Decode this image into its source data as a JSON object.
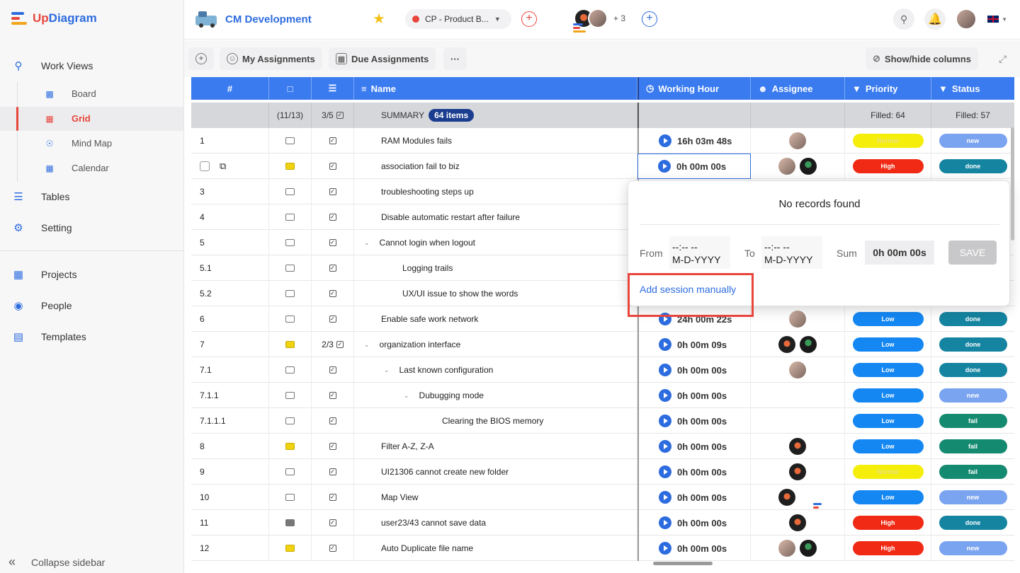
{
  "app": {
    "logo_up": "Up",
    "logo_rest": "Diagram"
  },
  "sidebar": {
    "work_views": "Work Views",
    "sub": [
      "Board",
      "Grid",
      "Mind Map",
      "Calendar"
    ],
    "tables": "Tables",
    "setting": "Setting",
    "projects": "Projects",
    "people": "People",
    "templates": "Templates",
    "collapse": "Collapse sidebar"
  },
  "topbar": {
    "project_title": "CM Development",
    "filter_label": "CP - Product B...",
    "members_more": "+ 3"
  },
  "toolbar": {
    "my_assignments": "My Assignments",
    "due_assignments": "Due Assignments",
    "more": "···",
    "show_hide": "Show/hide columns"
  },
  "grid": {
    "headers": {
      "num": "#",
      "name": "Name",
      "working_hour": "Working Hour",
      "assignee": "Assignee",
      "priority": "Priority",
      "status": "Status"
    },
    "summary": {
      "comments": "(11/13)",
      "checks": "3/5",
      "label": "SUMMARY",
      "items": "64 items",
      "priority_filled": "Filled: 64",
      "status_filled": "Filled: 57"
    },
    "rows": [
      {
        "num": "1",
        "cmt": "n",
        "chk": "",
        "name": "RAM Modules fails",
        "indent": 0,
        "caret": false,
        "time": "16h 03m 48s",
        "assignees": [
          "photo"
        ],
        "priority": "Normal",
        "status": "new"
      },
      {
        "num": "",
        "cmt": "y",
        "chk": "",
        "name": "association fail to biz",
        "indent": 0,
        "caret": false,
        "time": "0h 00m 00s",
        "assignees": [
          "photo",
          "green"
        ],
        "priority": "High",
        "status": "done"
      },
      {
        "num": "3",
        "cmt": "n",
        "chk": "",
        "name": "troubleshooting steps up",
        "indent": 0,
        "caret": false,
        "time": "",
        "assignees": [],
        "priority": "",
        "status": ""
      },
      {
        "num": "4",
        "cmt": "n",
        "chk": "",
        "name": "Disable automatic restart after failure",
        "indent": 0,
        "caret": false,
        "time": "",
        "assignees": [],
        "priority": "",
        "status": ""
      },
      {
        "num": "5",
        "cmt": "n",
        "chk": "",
        "name": "Cannot login when logout",
        "indent": 0,
        "caret": true,
        "time": "",
        "assignees": [],
        "priority": "",
        "status": ""
      },
      {
        "num": "5.1",
        "cmt": "n",
        "chk": "",
        "name": "Logging trails",
        "indent": 1,
        "caret": false,
        "time": "",
        "assignees": [],
        "priority": "",
        "status": ""
      },
      {
        "num": "5.2",
        "cmt": "n",
        "chk": "",
        "name": "UX/UI issue to show the words",
        "indent": 1,
        "caret": false,
        "time": "",
        "assignees": [],
        "priority": "",
        "status": ""
      },
      {
        "num": "6",
        "cmt": "n",
        "chk": "",
        "name": "Enable safe work network",
        "indent": 0,
        "caret": false,
        "time": "24h 00m 22s",
        "assignees": [
          "photo"
        ],
        "priority": "Low",
        "status": "done"
      },
      {
        "num": "7",
        "cmt": "y",
        "chk": "2/3",
        "name": "organization interface",
        "indent": 0,
        "caret": true,
        "time": "0h 00m 09s",
        "assignees": [
          "dark",
          "green"
        ],
        "priority": "Low",
        "status": "done"
      },
      {
        "num": "7.1",
        "cmt": "n",
        "chk": "",
        "name": "Last known configuration",
        "indent": 1,
        "caret": true,
        "time": "0h 00m 00s",
        "assignees": [
          "photo"
        ],
        "priority": "Low",
        "status": "done"
      },
      {
        "num": "7.1.1",
        "cmt": "n",
        "chk": "",
        "name": "Dubugging mode",
        "indent": 2,
        "caret": true,
        "time": "0h 00m 00s",
        "assignees": [],
        "priority": "Low",
        "status": "new"
      },
      {
        "num": "7.1.1.1",
        "cmt": "n",
        "chk": "",
        "name": "Clearing the BIOS memory",
        "indent": 3,
        "caret": false,
        "time": "0h 00m 00s",
        "assignees": [],
        "priority": "Low",
        "status": "fail"
      },
      {
        "num": "8",
        "cmt": "y",
        "chk": "",
        "name": "Filter A-Z, Z-A",
        "indent": 0,
        "caret": false,
        "time": "0h 00m 00s",
        "assignees": [
          "dark"
        ],
        "priority": "Low",
        "status": "fail"
      },
      {
        "num": "9",
        "cmt": "n",
        "chk": "",
        "name": "UI21306 cannot create new folder",
        "indent": 0,
        "caret": false,
        "time": "0h 00m 00s",
        "assignees": [
          "dark"
        ],
        "priority": "Normal",
        "status": "fail"
      },
      {
        "num": "10",
        "cmt": "n",
        "chk": "",
        "name": "Map View",
        "indent": 0,
        "caret": false,
        "time": "0h 00m 00s",
        "assignees": [
          "dark",
          "logo"
        ],
        "priority": "Low",
        "status": "new"
      },
      {
        "num": "11",
        "cmt": "g",
        "chk": "",
        "name": "user23/43 cannot save data",
        "indent": 0,
        "caret": false,
        "time": "0h 00m 00s",
        "assignees": [
          "dark"
        ],
        "priority": "High",
        "status": "done"
      },
      {
        "num": "12",
        "cmt": "y",
        "chk": "",
        "name": "Auto Duplicate file name",
        "indent": 0,
        "caret": false,
        "time": "0h 00m 00s",
        "assignees": [
          "photo",
          "green"
        ],
        "priority": "High",
        "status": "new"
      }
    ]
  },
  "colors": {
    "priority": {
      "Normal": "#f5ee0a",
      "High": "#f02a14",
      "Low": "#1487f2"
    },
    "status": {
      "new": "#7aa3f0",
      "done": "#1484a0",
      "fail": "#148a70"
    }
  },
  "popup": {
    "no_records": "No records found",
    "from_label": "From",
    "to_label": "To",
    "sum_label": "Sum",
    "time_placeholder": "--:-- --",
    "date_placeholder": "M-D-YYYY",
    "sum_value": "0h 00m 00s",
    "save": "SAVE",
    "add_session": "Add session manually"
  }
}
